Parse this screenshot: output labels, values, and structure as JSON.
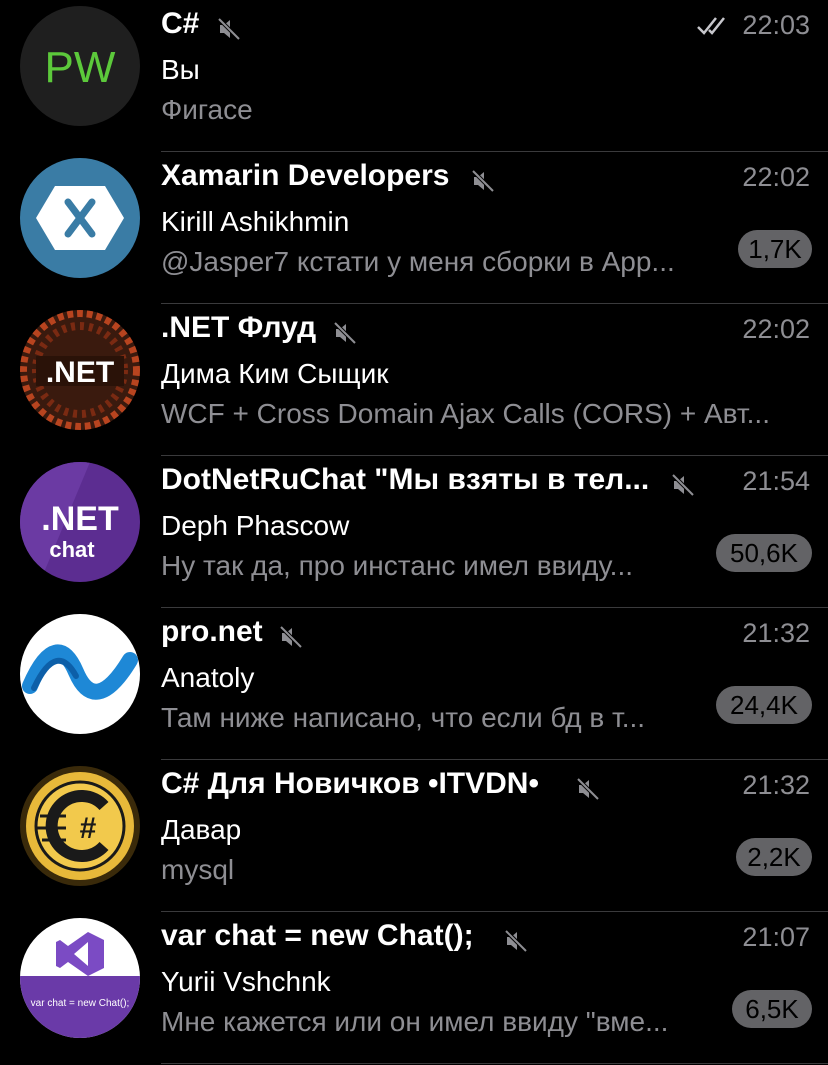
{
  "chats": [
    {
      "title": "C#",
      "time": "22:03",
      "sender": "Вы",
      "preview": "Фигасе",
      "badge": "",
      "read": true,
      "avatar": "pw-avatar",
      "avatar_text": "PW"
    },
    {
      "title": "Xamarin Developers",
      "time": "22:02",
      "sender": "Kirill Ashikhmin",
      "preview": "@Jasper7 кстати у меня сборки в App...",
      "badge": "1,7K",
      "avatar": "xamarin-logo"
    },
    {
      "title": ".NET Флуд",
      "time": "22:02",
      "sender": "Дима Ким Сыщик",
      "preview": "WCF + Cross Domain Ajax Calls (CORS) + Авт...",
      "badge": "",
      "avatar": "net-flood-logo",
      "avatar_text": ".NET"
    },
    {
      "title": "DotNetRuChat \"Мы взяты в тел...",
      "time": "21:54",
      "sender": "Deph Phascow",
      "preview": "Ну так да, про инстанс имел ввиду...",
      "badge": "50,6K",
      "avatar": "dotnetru-chat-logo",
      "avatar_text": ".NET",
      "avatar_subtext": "chat"
    },
    {
      "title": "pro.net",
      "time": "21:32",
      "sender": "Anatoly",
      "preview": "Там ниже написано, что если бд в т...",
      "badge": "24,4K",
      "avatar": "dotnet-wave-logo"
    },
    {
      "title": "C# Для Новичков •ITVDN•",
      "time": "21:32",
      "sender": "Давар",
      "preview": "mysql",
      "badge": "2,2K",
      "avatar": "csharp-coin-logo"
    },
    {
      "title": "var chat = new Chat();",
      "time": "21:07",
      "sender": "Yurii Vshchnk",
      "preview": "Мне кажется или он имел ввиду \"вме...",
      "badge": "6,5K",
      "avatar": "visual-studio-logo",
      "avatar_text": "var chat = new Chat();"
    }
  ],
  "colors": {
    "background": "#000000",
    "secondary_text": "#8e8e93",
    "badge_bg": "#636366",
    "separator": "#3a3a3c"
  }
}
